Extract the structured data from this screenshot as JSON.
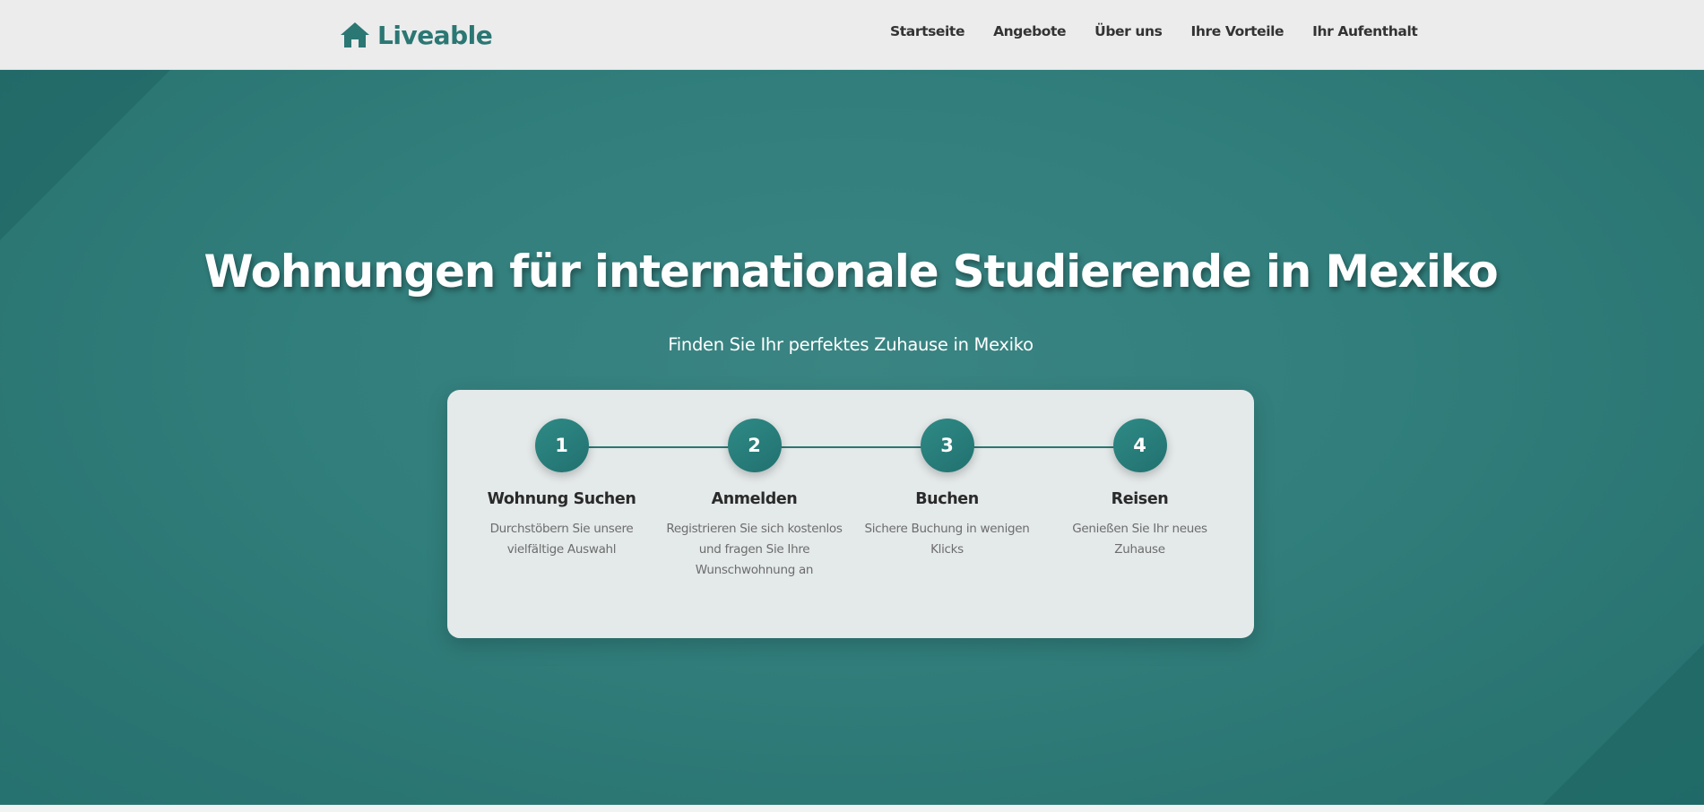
{
  "brand": {
    "name": "Liveable",
    "icon": "house-icon",
    "color": "#2b7774"
  },
  "nav": {
    "items": [
      {
        "label": "Startseite"
      },
      {
        "label": "Angebote"
      },
      {
        "label": "Über uns"
      },
      {
        "label": "Ihre Vorteile"
      },
      {
        "label": "Ihr Aufenthalt"
      }
    ]
  },
  "hero": {
    "title": "Wohnungen für internationale Studierende in Mexiko",
    "subtitle": "Finden Sie Ihr perfektes Zuhause in Mexiko",
    "background_color": "#317e7c"
  },
  "steps": [
    {
      "number": "1",
      "title": "Wohnung Suchen",
      "description": "Durchstöbern Sie unsere vielfältige Auswahl"
    },
    {
      "number": "2",
      "title": "Anmelden",
      "description": "Registrieren Sie sich kostenlos und fragen Sie Ihre Wunschwohnung an"
    },
    {
      "number": "3",
      "title": "Buchen",
      "description": "Sichere Buchung in wenigen Klicks"
    },
    {
      "number": "4",
      "title": "Reisen",
      "description": "Genießen Sie Ihr neues Zuhause"
    }
  ]
}
